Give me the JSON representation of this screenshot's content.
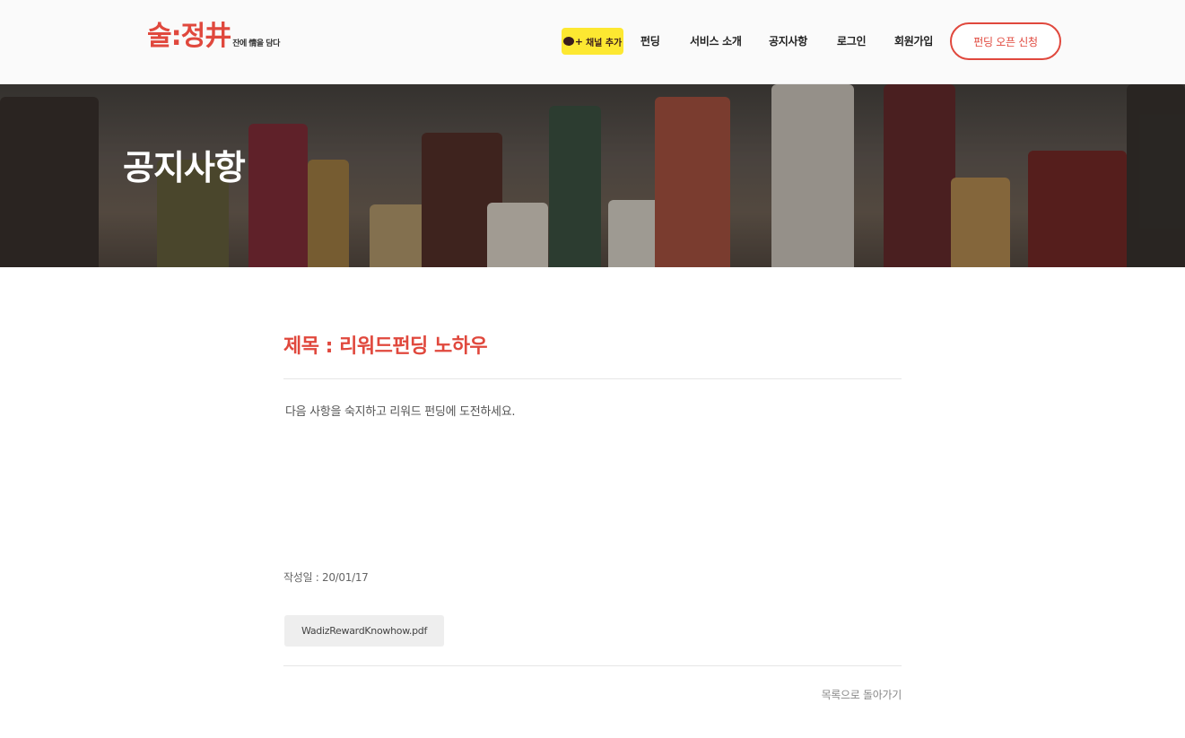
{
  "header": {
    "logo_main": "술:정井",
    "logo_sub": "잔에 情을 담다",
    "kakao_label": "채널 추가",
    "nav": [
      "펀딩",
      "서비스 소개",
      "공지사항",
      "로그인",
      "회원가입"
    ],
    "cta_label": "펀딩 오픈 신청"
  },
  "hero": {
    "title": "공지사항"
  },
  "post": {
    "title": "제목 : 리워드펀딩 노하우",
    "body": "다음 사항을 숙지하고 리워드 펀딩에 도전하세요.",
    "date": "작성일 : 20/01/17",
    "attachment": "WadizRewardKnowhow.pdf",
    "back_label": "목록으로 돌아가기"
  },
  "colors": {
    "accent": "#e0483d",
    "kakao": "#fde831"
  }
}
